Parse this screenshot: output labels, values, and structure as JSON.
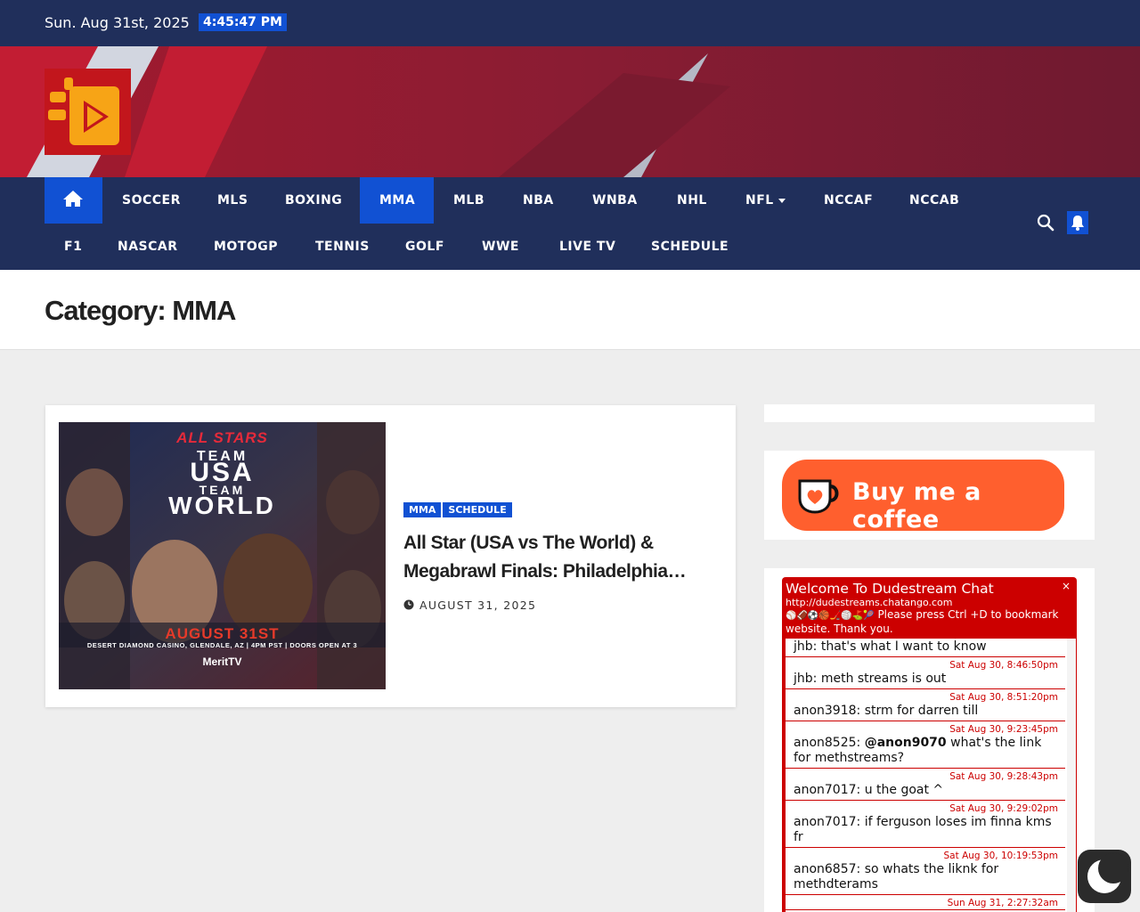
{
  "topbar": {
    "date": "Sun. Aug 31st, 2025",
    "time": "4:45:47 PM"
  },
  "nav": {
    "row1": [
      "SOCCER",
      "MLS",
      "BOXING",
      "MMA",
      "MLB",
      "NBA",
      "WNBA",
      "NHL",
      "NFL",
      "NCCAF",
      "NCCAB"
    ],
    "row2": [
      "F1",
      "NASCAR",
      "MOTOGP",
      "TENNIS",
      "GOLF",
      "WWE",
      "LIVE TV",
      "SCHEDULE"
    ],
    "active": "MMA",
    "accent": "#1151d3",
    "background": "#202f5b"
  },
  "category": {
    "title": "Category: MMA"
  },
  "post": {
    "tags": [
      "MMA",
      "SCHEDULE"
    ],
    "title": "All Star (USA vs The World) & Megabrawl Finals: Philadelphia…",
    "date": "AUGUST 31, 2025",
    "poster": {
      "brand": "ALL STARS",
      "line1": "TEAM",
      "line2": "USA",
      "line3": "TEAM",
      "line4": "WORLD",
      "event_date": "AUGUST 31ST",
      "venue": "DESERT DIAMOND CASINO, GLENDALE, AZ | 4PM PST | DOORS OPEN AT 3",
      "network": "MeritTV"
    }
  },
  "coffee": {
    "label": "Buy me a coffee",
    "color": "#ff5f2e"
  },
  "chat": {
    "title": "Welcome To Dudestream Chat",
    "url": "http://dudestreams.chatango.com",
    "desc": "Please press Ctrl +D to bookmark website. Thank you.",
    "close": "×",
    "messages": [
      {
        "ts": "",
        "user": "jhb",
        "mention": "",
        "text": "that's what I want to know"
      },
      {
        "ts": "Sat Aug 30, 8:46:50pm",
        "user": "jhb",
        "mention": "",
        "text": "meth streams is out"
      },
      {
        "ts": "Sat Aug 30, 8:51:20pm",
        "user": "anon3918",
        "mention": "",
        "text": "strm for darren till"
      },
      {
        "ts": "Sat Aug 30, 9:23:45pm",
        "user": "anon8525",
        "mention": "@anon9070",
        "text": "what's the link for methstreams?"
      },
      {
        "ts": "Sat Aug 30, 9:28:43pm",
        "user": "anon7017",
        "mention": "",
        "text": "u the goat ^"
      },
      {
        "ts": "Sat Aug 30, 9:29:02pm",
        "user": "anon7017",
        "mention": "",
        "text": "if ferguson loses im finna kms fr"
      },
      {
        "ts": "Sat Aug 30, 10:19:53pm",
        "user": "anon6857",
        "mention": "",
        "text": "so whats the liknk for methdterams"
      },
      {
        "ts": "Sun Aug 31, 2:27:32am",
        "user": "",
        "mention": "",
        "text": ""
      }
    ]
  }
}
